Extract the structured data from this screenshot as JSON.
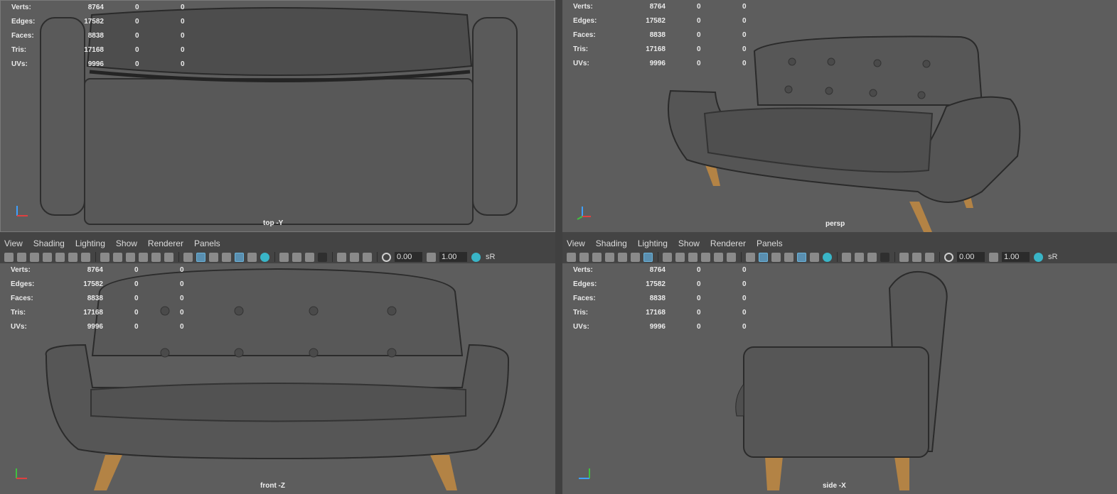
{
  "stats": {
    "rows": [
      {
        "label": "Verts:",
        "v1": "8764",
        "v2": "0",
        "v3": "0"
      },
      {
        "label": "Edges:",
        "v1": "17582",
        "v2": "0",
        "v3": "0"
      },
      {
        "label": "Faces:",
        "v1": "8838",
        "v2": "0",
        "v3": "0"
      },
      {
        "label": "Tris:",
        "v1": "17168",
        "v2": "0",
        "v3": "0"
      },
      {
        "label": "UVs:",
        "v1": "9996",
        "v2": "0",
        "v3": "0"
      }
    ]
  },
  "viewports": {
    "top": {
      "camera": "top -Y"
    },
    "persp": {
      "camera": "persp"
    },
    "front": {
      "camera": "front -Z"
    },
    "side": {
      "camera": "side -X"
    }
  },
  "panel_menu": [
    "View",
    "Shading",
    "Lighting",
    "Show",
    "Renderer",
    "Panels"
  ],
  "toolbar": {
    "exposure": "0.00",
    "gamma": "1.00",
    "color_space": "sR"
  },
  "colors": {
    "viewport_bg": "#5d5d5d",
    "fabric": "#595959",
    "legs": "#b38345",
    "highlight": "#39b5c7"
  }
}
